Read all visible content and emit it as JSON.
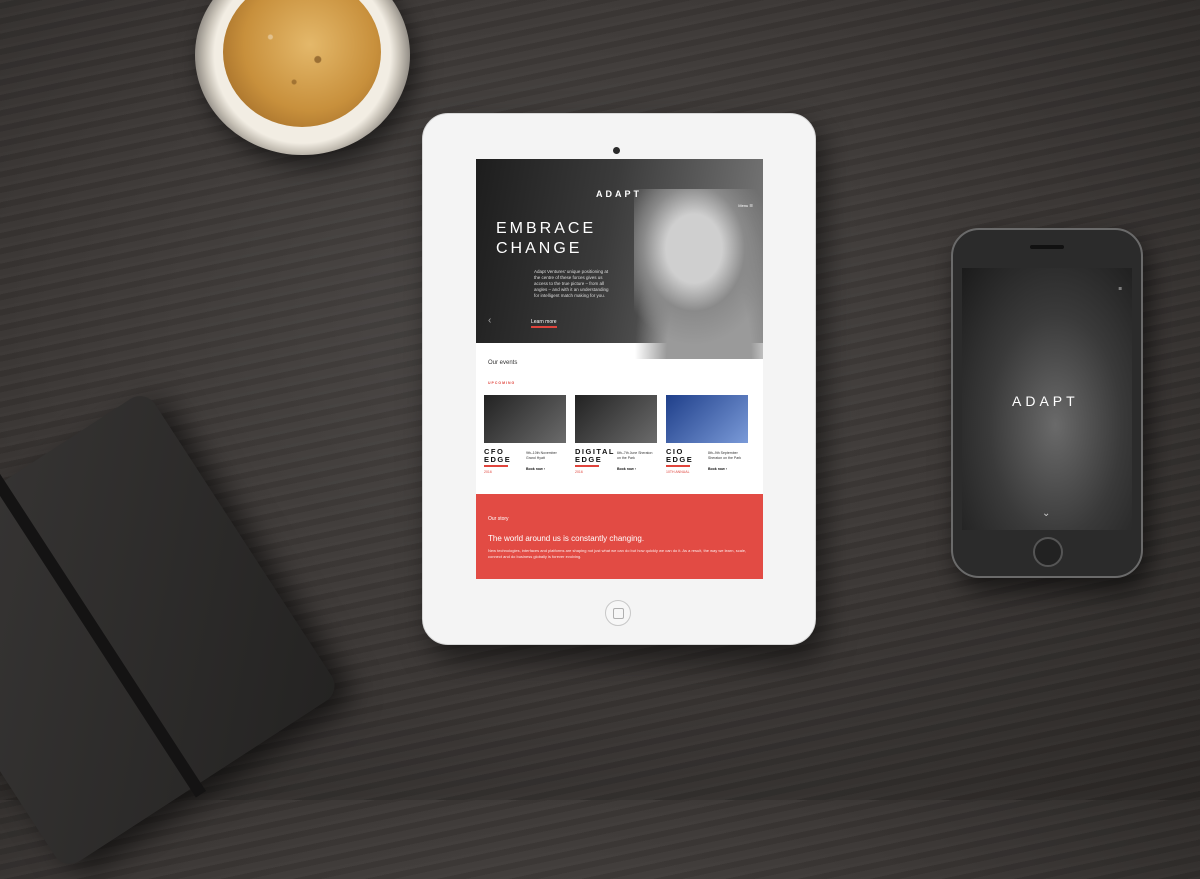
{
  "tablet": {
    "site_logo": "ADAPT",
    "menu_label": "Menu",
    "menu_icon": "hamburger-icon",
    "hero": {
      "headline_line1": "EMBRACE",
      "headline_line2": "CHANGE",
      "body": "Adapt Ventures' unique positioning at the centre of these forces gives us access to the true picture – from all angles – and with it an understanding for intelligent match making for you.",
      "cta": "Learn more",
      "prev_icon": "chevron-left-icon"
    },
    "events": {
      "section_title": "Our events",
      "tag": "UPCOMING",
      "items": [
        {
          "name_line1": "CFO",
          "name_line2": "EDGE",
          "year": "2016",
          "meta": "9th–10th November Grand Hyatt",
          "cta": "Book now ›"
        },
        {
          "name_line1": "DIGITAL",
          "name_line2": "EDGE",
          "year": "2016",
          "meta": "6th–7th June Sheraton on the Park",
          "cta": "Book now ›"
        },
        {
          "name_line1": "CIO",
          "name_line2": "EDGE",
          "year": "10TH ANNUAL",
          "meta": "8th–9th September Sheraton on the Park",
          "cta": "Book now ›"
        }
      ]
    },
    "story": {
      "title": "Our story",
      "headline": "The world around us is constantly changing.",
      "body": "New technologies, interfaces and platforms are shaping not just what we can do but how quickly we can do it. As a result, the way we learn, scale, connect and do business globally is forever evolving."
    }
  },
  "phone": {
    "logo": "ADAPT",
    "menu_icon": "hamburger-icon",
    "scroll_icon": "chevron-down-icon"
  },
  "colors": {
    "accent": "#e24b44",
    "hero_dark": "#1d1d1d"
  }
}
